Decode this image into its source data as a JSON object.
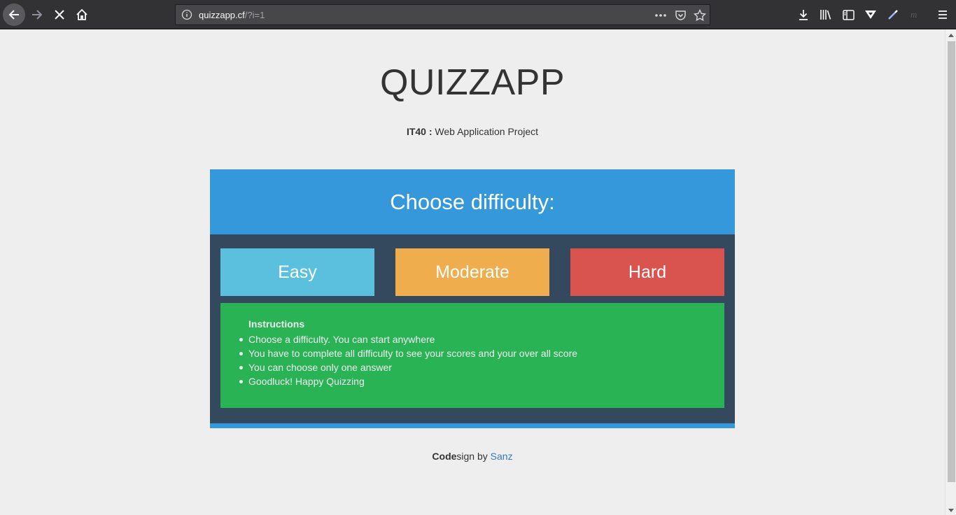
{
  "browser": {
    "url_host": "quizzapp.cf",
    "url_path": "/?i=1"
  },
  "header": {
    "title": "QUIZZAPP",
    "subtitle_bold": "IT40 :",
    "subtitle_text": " Web Application Project"
  },
  "panel": {
    "heading": "Choose difficulty:",
    "buttons": {
      "easy": "Easy",
      "moderate": "Moderate",
      "hard": "Hard"
    },
    "instructions": {
      "title": "Instructions",
      "items": [
        "Choose a difficulty. You can start anywhere",
        "You have to complete all difficulty to see your scores and your over all score",
        "You can choose only one answer",
        "Goodluck! Happy Quizzing"
      ]
    }
  },
  "footer": {
    "bold": "Code",
    "text": "sign by ",
    "link": "Sanz"
  },
  "colors": {
    "header_blue": "#3498db",
    "panel_dark": "#34495e",
    "easy": "#5bc0de",
    "moderate": "#f0ad4e",
    "hard": "#d9534f",
    "instructions_green": "#2ab354"
  }
}
